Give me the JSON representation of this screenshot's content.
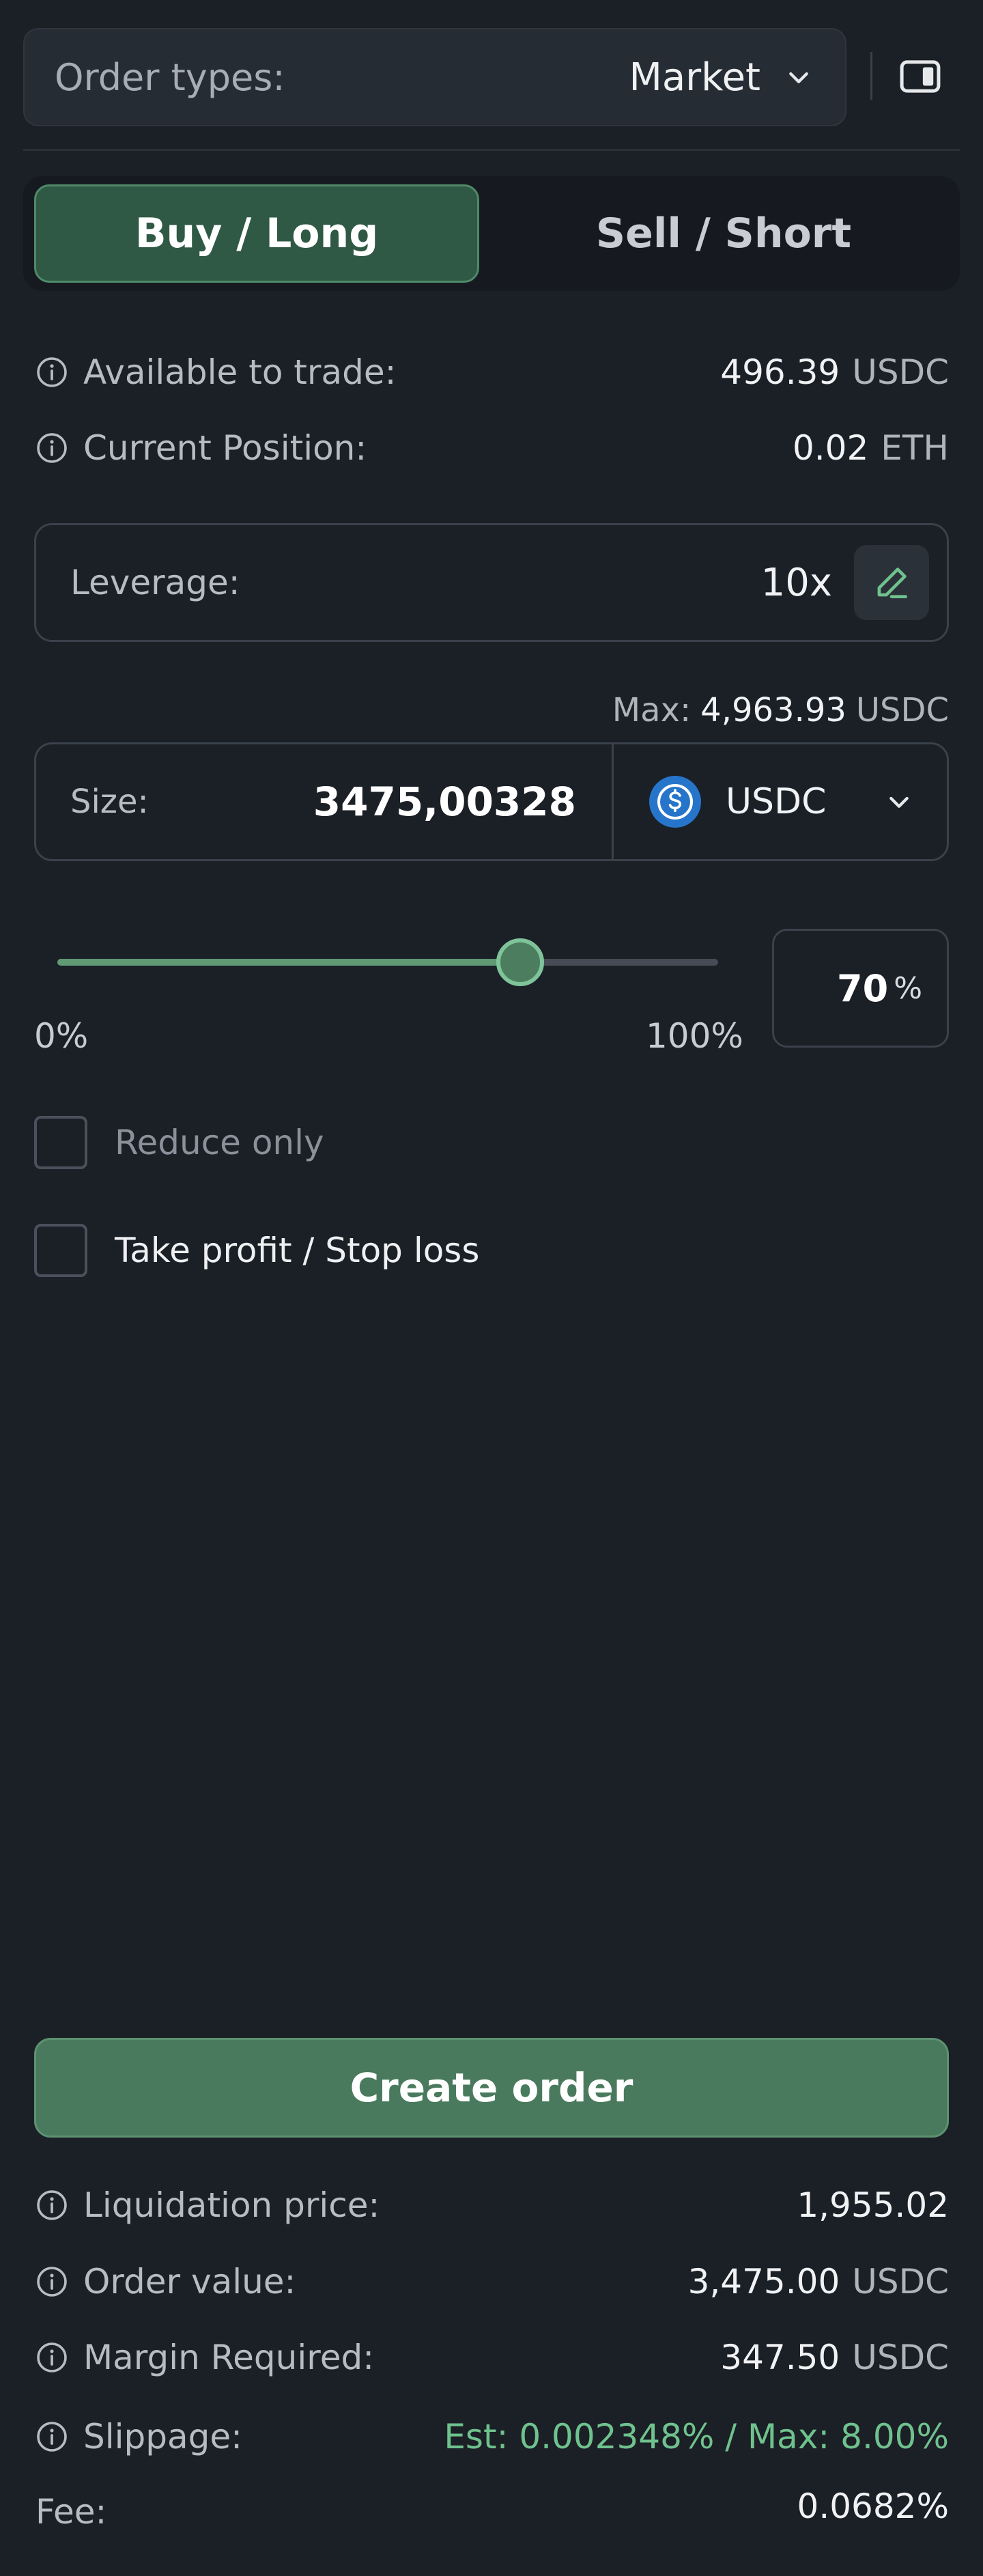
{
  "header": {
    "order_types_label": "Order types:",
    "order_type_value": "Market"
  },
  "tabs": {
    "buy_label": "Buy / Long",
    "sell_label": "Sell / Short",
    "active": "buy"
  },
  "account": {
    "available_label": "Available to trade:",
    "available_value": "496.39",
    "available_unit": "USDC",
    "position_label": "Current Position:",
    "position_value": "0.02",
    "position_unit": "ETH"
  },
  "leverage": {
    "label": "Leverage:",
    "value": "10x"
  },
  "size": {
    "max_label": "Max:",
    "max_value": "4,963.93",
    "max_unit": "USDC",
    "label": "Size:",
    "value": "3475,00328",
    "currency": "USDC"
  },
  "slider": {
    "min_label": "0%",
    "max_label": "100%",
    "percent_value": "70",
    "percent_symbol": "%",
    "fraction": 0.7
  },
  "options": {
    "reduce_only_label": "Reduce only",
    "tpsl_label": "Take profit / Stop loss"
  },
  "actions": {
    "create_order_label": "Create order"
  },
  "summary": {
    "liquidation_label": "Liquidation price:",
    "liquidation_value": "1,955.02",
    "order_value_label": "Order value:",
    "order_value": "3,475.00",
    "order_value_unit": "USDC",
    "margin_label": "Margin Required:",
    "margin_value": "347.50",
    "margin_unit": "USDC",
    "slippage_label": "Slippage:",
    "slippage_value": "Est: 0.002348% / Max: 8.00%",
    "fee_label": "Fee:",
    "fee_value": "0.0682%"
  },
  "colors": {
    "background": "#1b1f26",
    "accent_green": "#4a7a5e",
    "positive_text": "#6fc28d",
    "usdc_blue": "#2775ca"
  }
}
